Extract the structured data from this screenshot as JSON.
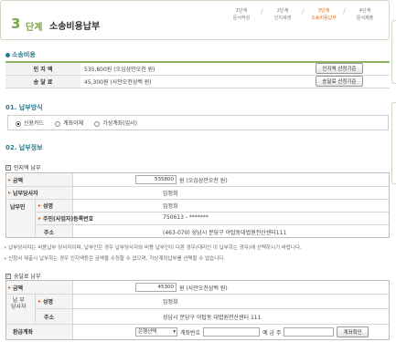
{
  "header": {
    "step_num": "3",
    "step_word": "단계",
    "title": "소송비용납부",
    "steps": [
      {
        "label": "1단계\n문서작성",
        "active": false
      },
      {
        "label": "2단계\n인지세생",
        "active": false
      },
      {
        "label": "3단계\n소송비용납부",
        "active": true
      },
      {
        "label": "4단계\n문서제출",
        "active": false
      }
    ]
  },
  "costs": {
    "heading": "소송비용",
    "rows": [
      {
        "label": "인 지 액",
        "value": "535,800원 (오십삼만오천 원)",
        "button": "인지액 산정기준"
      },
      {
        "label": "송 달 료",
        "value": "45,300원 (사만오천삼백 원)",
        "button": "송달료 산정기준"
      }
    ]
  },
  "method": {
    "heading": "01. 납부방식",
    "options": [
      {
        "label": "신용카드",
        "selected": true
      },
      {
        "label": "계좌이체",
        "selected": false
      },
      {
        "label": "가상계좌(입사)",
        "selected": false
      }
    ]
  },
  "info": {
    "heading": "02. 납부정보",
    "stamp": {
      "check_label": "인지액 납부",
      "amount_label": "금액",
      "amount_value": "535800",
      "amount_suffix": "원 (오십삼만오천 원)",
      "payer_label": "납부당사자",
      "payer_value": "임정희",
      "payer_group_label": "납부인",
      "name_label": "성명",
      "name_value": "임정희",
      "id_label": "주민(사업자)등록번호",
      "id_value": "750613 - *******",
      "addr_label": "주소",
      "addr_value": "(463-070) 성남시 분당구 야탑동대법원전산센터111"
    },
    "notes": [
      "» 납부당사자는 비용납부 당사자이며, 납부인은 경우 납부당사자와 비용 납부인이 다른 경우(대리인 이 납부하는 경우)에 선택하시기 바랍니다.",
      "» 신청서 제출시 납부하는 경우 인지액등은 금액을 수정할 수 없으며, 가상계좌납부를 선택할 수 없습니다."
    ],
    "delivery": {
      "check_label": "송달료 납부",
      "amount_label": "금액",
      "amount_value": "45300",
      "amount_suffix": "원 (사만오천삼백 원)",
      "payer_label": "납 부\n당사자",
      "name_label": "성명",
      "name_value": "임정희",
      "addr_label": "주소",
      "addr_value": "성남시 분당구 야탑동 대법원전산센터 111",
      "refund_label": "환급계좌",
      "bank_select": "은행선택",
      "account_label": "계좌번호",
      "holder_label": "예 금 주",
      "verify_button": "계좌확인"
    }
  }
}
